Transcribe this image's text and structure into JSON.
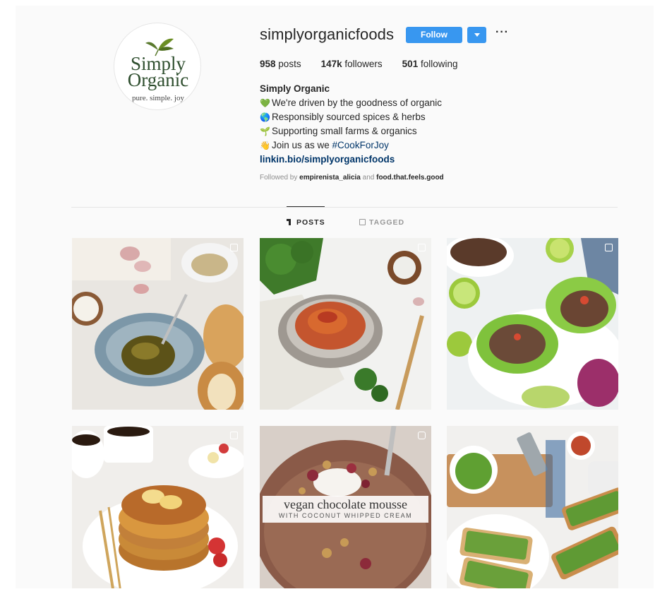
{
  "profile": {
    "avatar_line1": "Simply",
    "avatar_line2": "Organic",
    "avatar_tagline": "pure. simple. joy",
    "username": "simplyorganicfoods",
    "follow_label": "Follow",
    "more_label": "···",
    "stats": {
      "posts_count": "958",
      "posts_label": "posts",
      "followers_count": "147k",
      "followers_label": "followers",
      "following_count": "501",
      "following_label": "following"
    },
    "bio": {
      "name": "Simply Organic",
      "line1": "We're driven by the goodness of organic",
      "line2": "Responsibly sourced spices & herbs",
      "line3": "Supporting small farms & organics",
      "line4_prefix": "Join us as we ",
      "line4_hashtag": "#CookForJoy",
      "link": "linkin.bio/simplyorganicfoods",
      "emoji1": "💚",
      "emoji2": "🌎",
      "emoji3": "🌱",
      "emoji4": "👋"
    },
    "followed_by": {
      "prefix": "Followed by",
      "user1": "empirenista_alicia",
      "and": "and",
      "user2": "food.that.feels.good"
    }
  },
  "tabs": {
    "posts": "POSTS",
    "tagged": "TAGGED"
  },
  "posts": {
    "p5_title": "vegan chocolate mousse",
    "p5_subtitle": "WITH COCONUT WHIPPED CREAM"
  },
  "colors": {
    "accent": "#3897f0",
    "link": "#003569"
  }
}
